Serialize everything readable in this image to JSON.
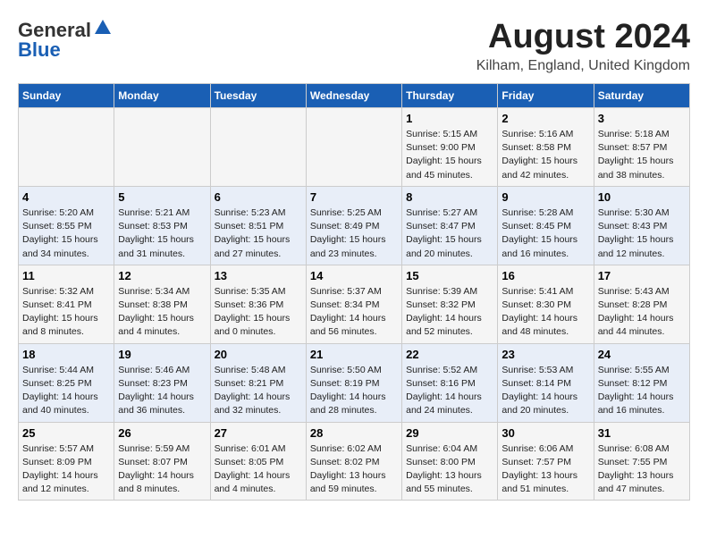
{
  "header": {
    "logo_general": "General",
    "logo_blue": "Blue",
    "main_title": "August 2024",
    "subtitle": "Kilham, England, United Kingdom"
  },
  "calendar": {
    "days_of_week": [
      "Sunday",
      "Monday",
      "Tuesday",
      "Wednesday",
      "Thursday",
      "Friday",
      "Saturday"
    ],
    "weeks": [
      [
        {
          "day": "",
          "info": ""
        },
        {
          "day": "",
          "info": ""
        },
        {
          "day": "",
          "info": ""
        },
        {
          "day": "",
          "info": ""
        },
        {
          "day": "1",
          "info": "Sunrise: 5:15 AM\nSunset: 9:00 PM\nDaylight: 15 hours\nand 45 minutes."
        },
        {
          "day": "2",
          "info": "Sunrise: 5:16 AM\nSunset: 8:58 PM\nDaylight: 15 hours\nand 42 minutes."
        },
        {
          "day": "3",
          "info": "Sunrise: 5:18 AM\nSunset: 8:57 PM\nDaylight: 15 hours\nand 38 minutes."
        }
      ],
      [
        {
          "day": "4",
          "info": "Sunrise: 5:20 AM\nSunset: 8:55 PM\nDaylight: 15 hours\nand 34 minutes."
        },
        {
          "day": "5",
          "info": "Sunrise: 5:21 AM\nSunset: 8:53 PM\nDaylight: 15 hours\nand 31 minutes."
        },
        {
          "day": "6",
          "info": "Sunrise: 5:23 AM\nSunset: 8:51 PM\nDaylight: 15 hours\nand 27 minutes."
        },
        {
          "day": "7",
          "info": "Sunrise: 5:25 AM\nSunset: 8:49 PM\nDaylight: 15 hours\nand 23 minutes."
        },
        {
          "day": "8",
          "info": "Sunrise: 5:27 AM\nSunset: 8:47 PM\nDaylight: 15 hours\nand 20 minutes."
        },
        {
          "day": "9",
          "info": "Sunrise: 5:28 AM\nSunset: 8:45 PM\nDaylight: 15 hours\nand 16 minutes."
        },
        {
          "day": "10",
          "info": "Sunrise: 5:30 AM\nSunset: 8:43 PM\nDaylight: 15 hours\nand 12 minutes."
        }
      ],
      [
        {
          "day": "11",
          "info": "Sunrise: 5:32 AM\nSunset: 8:41 PM\nDaylight: 15 hours\nand 8 minutes."
        },
        {
          "day": "12",
          "info": "Sunrise: 5:34 AM\nSunset: 8:38 PM\nDaylight: 15 hours\nand 4 minutes."
        },
        {
          "day": "13",
          "info": "Sunrise: 5:35 AM\nSunset: 8:36 PM\nDaylight: 15 hours\nand 0 minutes."
        },
        {
          "day": "14",
          "info": "Sunrise: 5:37 AM\nSunset: 8:34 PM\nDaylight: 14 hours\nand 56 minutes."
        },
        {
          "day": "15",
          "info": "Sunrise: 5:39 AM\nSunset: 8:32 PM\nDaylight: 14 hours\nand 52 minutes."
        },
        {
          "day": "16",
          "info": "Sunrise: 5:41 AM\nSunset: 8:30 PM\nDaylight: 14 hours\nand 48 minutes."
        },
        {
          "day": "17",
          "info": "Sunrise: 5:43 AM\nSunset: 8:28 PM\nDaylight: 14 hours\nand 44 minutes."
        }
      ],
      [
        {
          "day": "18",
          "info": "Sunrise: 5:44 AM\nSunset: 8:25 PM\nDaylight: 14 hours\nand 40 minutes."
        },
        {
          "day": "19",
          "info": "Sunrise: 5:46 AM\nSunset: 8:23 PM\nDaylight: 14 hours\nand 36 minutes."
        },
        {
          "day": "20",
          "info": "Sunrise: 5:48 AM\nSunset: 8:21 PM\nDaylight: 14 hours\nand 32 minutes."
        },
        {
          "day": "21",
          "info": "Sunrise: 5:50 AM\nSunset: 8:19 PM\nDaylight: 14 hours\nand 28 minutes."
        },
        {
          "day": "22",
          "info": "Sunrise: 5:52 AM\nSunset: 8:16 PM\nDaylight: 14 hours\nand 24 minutes."
        },
        {
          "day": "23",
          "info": "Sunrise: 5:53 AM\nSunset: 8:14 PM\nDaylight: 14 hours\nand 20 minutes."
        },
        {
          "day": "24",
          "info": "Sunrise: 5:55 AM\nSunset: 8:12 PM\nDaylight: 14 hours\nand 16 minutes."
        }
      ],
      [
        {
          "day": "25",
          "info": "Sunrise: 5:57 AM\nSunset: 8:09 PM\nDaylight: 14 hours\nand 12 minutes."
        },
        {
          "day": "26",
          "info": "Sunrise: 5:59 AM\nSunset: 8:07 PM\nDaylight: 14 hours\nand 8 minutes."
        },
        {
          "day": "27",
          "info": "Sunrise: 6:01 AM\nSunset: 8:05 PM\nDaylight: 14 hours\nand 4 minutes."
        },
        {
          "day": "28",
          "info": "Sunrise: 6:02 AM\nSunset: 8:02 PM\nDaylight: 13 hours\nand 59 minutes."
        },
        {
          "day": "29",
          "info": "Sunrise: 6:04 AM\nSunset: 8:00 PM\nDaylight: 13 hours\nand 55 minutes."
        },
        {
          "day": "30",
          "info": "Sunrise: 6:06 AM\nSunset: 7:57 PM\nDaylight: 13 hours\nand 51 minutes."
        },
        {
          "day": "31",
          "info": "Sunrise: 6:08 AM\nSunset: 7:55 PM\nDaylight: 13 hours\nand 47 minutes."
        }
      ]
    ]
  }
}
